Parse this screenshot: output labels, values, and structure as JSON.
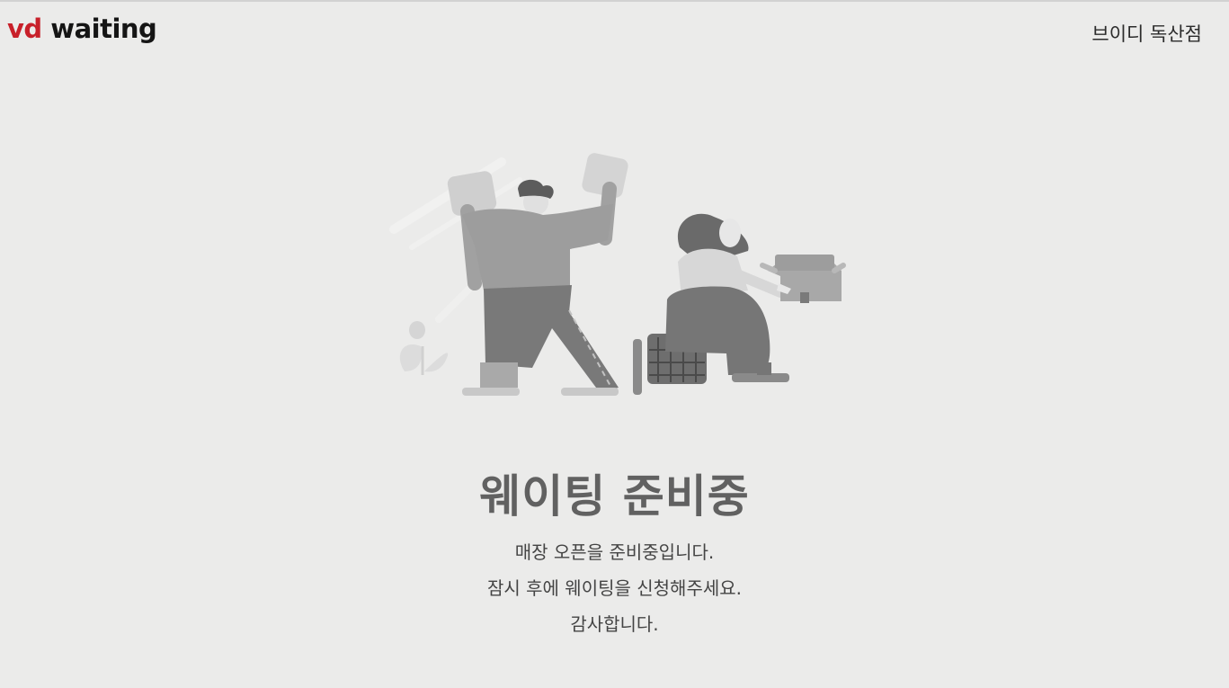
{
  "header": {
    "logo": {
      "part1": "vd",
      "part2": "waiting"
    },
    "store_name": "브이디 독산점"
  },
  "illustration": {
    "icon": "people-preparing-illustration"
  },
  "status": {
    "title": "웨이팅 준비중",
    "lines": [
      "매장 오픈을 준비중입니다.",
      "잠시 후에 웨이팅을 신청해주세요.",
      "감사합니다."
    ]
  },
  "colors": {
    "background": "#ebebea",
    "brand_red": "#c8202a",
    "title_gray": "#616161"
  }
}
